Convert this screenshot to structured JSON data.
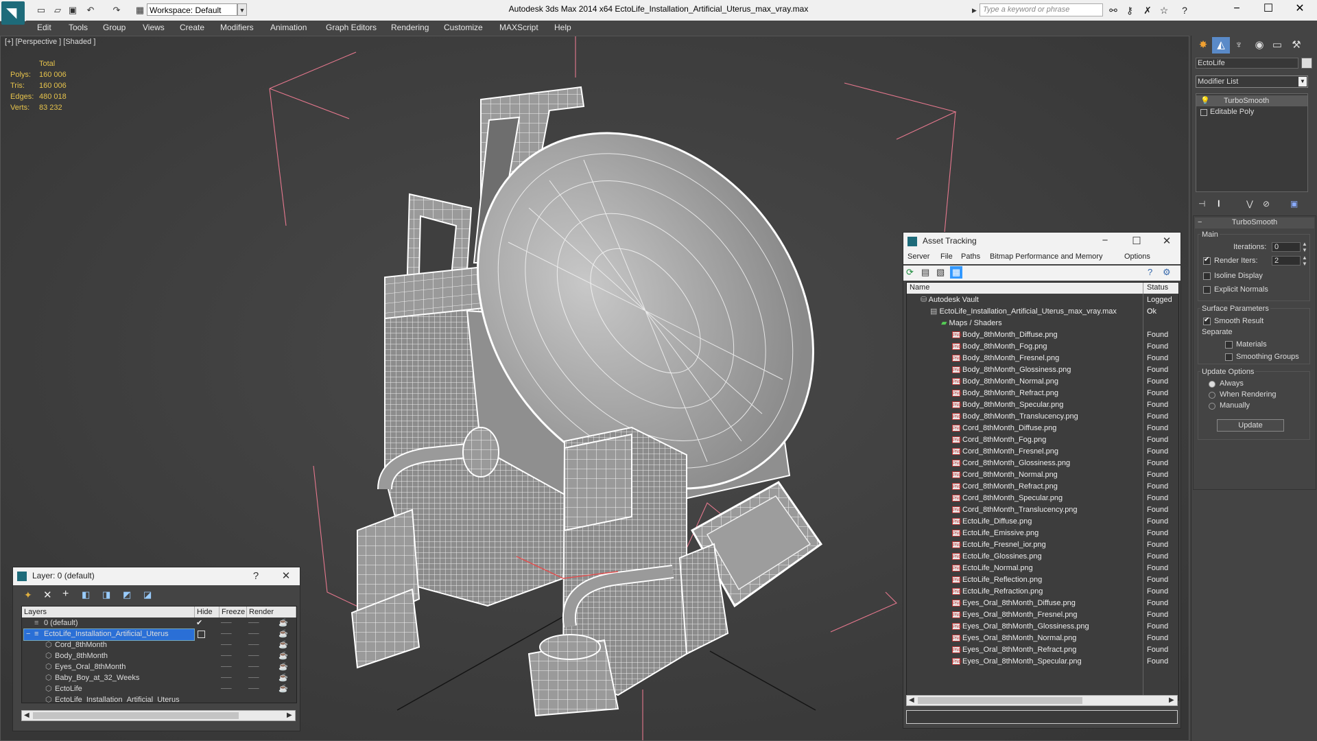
{
  "app": {
    "title": "Autodesk 3ds Max  2014 x64      EctoLife_Installation_Artificial_Uterus_max_vray.max",
    "workspace": "Workspace: Default",
    "search_placeholder": "Type a keyword or phrase"
  },
  "menu": [
    "Edit",
    "Tools",
    "Group",
    "Views",
    "Create",
    "Modifiers",
    "Animation",
    "Graph Editors",
    "Rendering",
    "Customize",
    "MAXScript",
    "Help"
  ],
  "viewport": {
    "label": "[+] [Perspective ] [Shaded ]",
    "stats_header": "Total",
    "stats": [
      {
        "label": "Polys:",
        "value": "160 006"
      },
      {
        "label": "Tris:",
        "value": "160 006"
      },
      {
        "label": "Edges:",
        "value": "480 018"
      },
      {
        "label": "Verts:",
        "value": "83 232"
      }
    ]
  },
  "layer_panel": {
    "title": "Layer: 0 (default)",
    "help": "?",
    "columns": [
      "Layers",
      "Hide",
      "Freeze",
      "Render"
    ],
    "rows": [
      {
        "name": "0 (default)",
        "level": 0,
        "selected": false
      },
      {
        "name": "EctoLife_Installation_Artificial_Uterus",
        "level": 0,
        "selected": true
      },
      {
        "name": "Cord_8thMonth",
        "level": 1,
        "selected": false
      },
      {
        "name": "Body_8thMonth",
        "level": 1,
        "selected": false
      },
      {
        "name": "Eyes_Oral_8thMonth",
        "level": 1,
        "selected": false
      },
      {
        "name": "Baby_Boy_at_32_Weeks",
        "level": 1,
        "selected": false
      },
      {
        "name": "EctoLife",
        "level": 1,
        "selected": false
      },
      {
        "name": "EctoLife_Installation_Artificial_Uterus",
        "level": 1,
        "selected": false
      }
    ]
  },
  "asset_panel": {
    "title": "Asset Tracking",
    "menu": [
      "Server",
      "File",
      "Paths",
      "Bitmap Performance and Memory",
      "Options"
    ],
    "columns": [
      "Name",
      "Status"
    ],
    "vault": {
      "name": "Autodesk Vault",
      "status": "Logged O"
    },
    "file": {
      "name": "EctoLife_Installation_Artificial_Uterus_max_vray.max",
      "status": "Ok"
    },
    "group": "Maps / Shaders",
    "png_badge": "PNG",
    "maps": [
      {
        "name": "Body_8thMonth_Diffuse.png",
        "status": "Found"
      },
      {
        "name": "Body_8thMonth_Fog.png",
        "status": "Found"
      },
      {
        "name": "Body_8thMonth_Fresnel.png",
        "status": "Found"
      },
      {
        "name": "Body_8thMonth_Glossiness.png",
        "status": "Found"
      },
      {
        "name": "Body_8thMonth_Normal.png",
        "status": "Found"
      },
      {
        "name": "Body_8thMonth_Refract.png",
        "status": "Found"
      },
      {
        "name": "Body_8thMonth_Specular.png",
        "status": "Found"
      },
      {
        "name": "Body_8thMonth_Translucency.png",
        "status": "Found"
      },
      {
        "name": "Cord_8thMonth_Diffuse.png",
        "status": "Found"
      },
      {
        "name": "Cord_8thMonth_Fog.png",
        "status": "Found"
      },
      {
        "name": "Cord_8thMonth_Fresnel.png",
        "status": "Found"
      },
      {
        "name": "Cord_8thMonth_Glossiness.png",
        "status": "Found"
      },
      {
        "name": "Cord_8thMonth_Normal.png",
        "status": "Found"
      },
      {
        "name": "Cord_8thMonth_Refract.png",
        "status": "Found"
      },
      {
        "name": "Cord_8thMonth_Specular.png",
        "status": "Found"
      },
      {
        "name": "Cord_8thMonth_Translucency.png",
        "status": "Found"
      },
      {
        "name": "EctoLife_Diffuse.png",
        "status": "Found"
      },
      {
        "name": "EctoLife_Emissive.png",
        "status": "Found"
      },
      {
        "name": "EctoLife_Fresnel_ior.png",
        "status": "Found"
      },
      {
        "name": "EctoLife_Glossines.png",
        "status": "Found"
      },
      {
        "name": "EctoLife_Normal.png",
        "status": "Found"
      },
      {
        "name": "EctoLife_Reflection.png",
        "status": "Found"
      },
      {
        "name": "EctoLife_Refraction.png",
        "status": "Found"
      },
      {
        "name": "Eyes_Oral_8thMonth_Diffuse.png",
        "status": "Found"
      },
      {
        "name": "Eyes_Oral_8thMonth_Fresnel.png",
        "status": "Found"
      },
      {
        "name": "Eyes_Oral_8thMonth_Glossiness.png",
        "status": "Found"
      },
      {
        "name": "Eyes_Oral_8thMonth_Normal.png",
        "status": "Found"
      },
      {
        "name": "Eyes_Oral_8thMonth_Refract.png",
        "status": "Found"
      },
      {
        "name": "Eyes_Oral_8thMonth_Specular.png",
        "status": "Found"
      }
    ]
  },
  "command_panel": {
    "object_name": "EctoLife",
    "modifier_list": "Modifier List",
    "stack": [
      "TurboSmooth",
      "Editable Poly"
    ],
    "turbosmooth": {
      "title": "TurboSmooth",
      "main": "Main",
      "iterations_label": "Iterations:",
      "iterations": "0",
      "render_iters_label": "Render Iters:",
      "render_iters": "2",
      "isoline": "Isoline Display",
      "explicit": "Explicit Normals",
      "surface": "Surface Parameters",
      "smooth_result": "Smooth Result",
      "separate": "Separate",
      "materials": "Materials",
      "smoothing_groups": "Smoothing Groups",
      "update_options": "Update Options",
      "always": "Always",
      "when_rendering": "When Rendering",
      "manually": "Manually",
      "update": "Update"
    }
  },
  "colors": {
    "accent": "#3399ff",
    "selected": "#2a6fd6",
    "stats": "#e6c34c",
    "wire": "#e9e9e9"
  }
}
